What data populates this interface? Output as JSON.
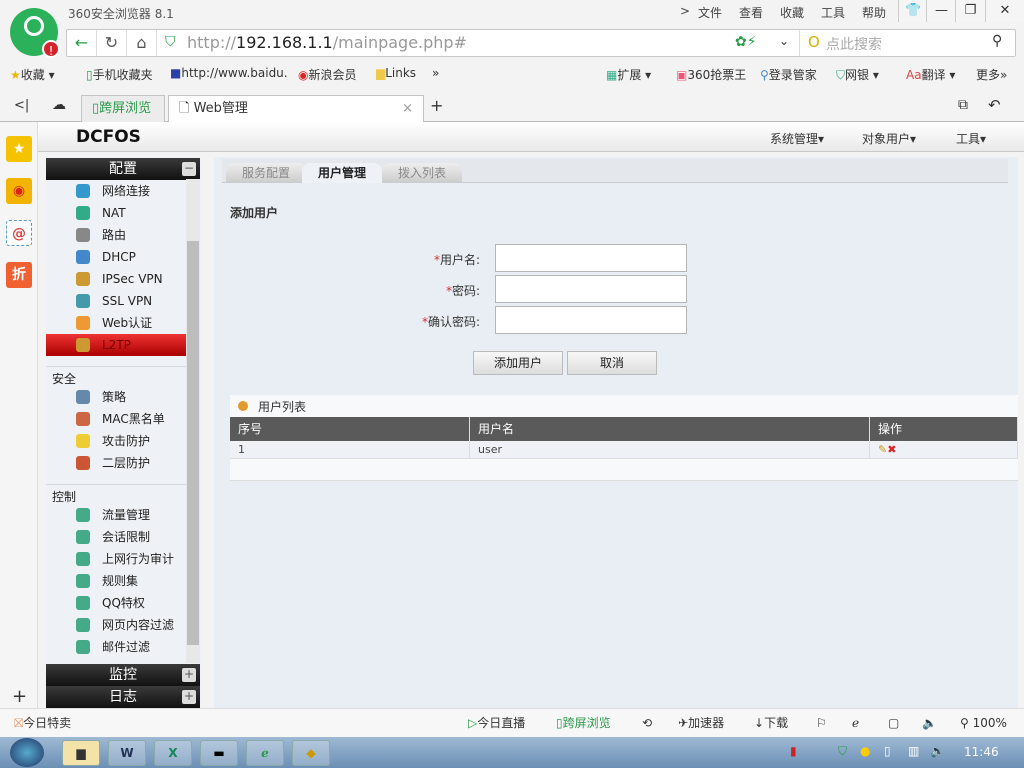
{
  "browser": {
    "title": "360安全浏览器 8.1",
    "menu": [
      ">",
      "文件",
      "查看",
      "收藏",
      "工具",
      "帮助"
    ],
    "url_prefix": "http://",
    "url_host": "192.168.1.1",
    "url_path": "/mainpage.php#",
    "search_placeholder": "点此搜索",
    "bookmarks": [
      "收藏",
      "手机收藏夹",
      "http://www.baidu.",
      "新浪会员",
      "Links",
      "»"
    ],
    "tools": [
      "扩展",
      "360抢票王",
      "登录管家",
      "网银",
      "翻译",
      "更多"
    ],
    "tabs": [
      {
        "label": "跨屏浏览"
      },
      {
        "label": "Web管理"
      }
    ]
  },
  "app": {
    "logo": "DCFOS",
    "menu": [
      "系统管理▾",
      "对象用户▾",
      "工具▾"
    ]
  },
  "nav": {
    "config_header": "配置",
    "config_items": [
      "网络连接",
      "NAT",
      "路由",
      "DHCP",
      "IPSec VPN",
      "SSL VPN",
      "Web认证",
      "L2TP"
    ],
    "security_label": "安全",
    "security_items": [
      "策略",
      "MAC黑名单",
      "攻击防护",
      "二层防护"
    ],
    "control_label": "控制",
    "control_items": [
      "流量管理",
      "会话限制",
      "上网行为审计",
      "规则集",
      "QQ特权",
      "网页内容过滤",
      "邮件过滤"
    ],
    "monitor_header": "监控",
    "log_header": "日志",
    "minus": "−",
    "plus": "+"
  },
  "page": {
    "tabs": [
      "服务配置",
      "用户管理",
      "拨入列表"
    ],
    "section_title": "添加用户",
    "form": {
      "required": "*",
      "username_label": "用户名:",
      "password_label": "密码:",
      "confirm_label": "确认密码:",
      "username": "",
      "password": "",
      "confirm": ""
    },
    "add_button": "添加用户",
    "cancel_button": "取消",
    "list_title": "用户列表",
    "columns": [
      "序号",
      "用户名",
      "操作"
    ],
    "rows": [
      {
        "index": "1",
        "username": "user"
      }
    ]
  },
  "status": {
    "left": "今日特卖",
    "items": [
      "今日直播",
      "跨屏浏览",
      "加速器",
      "下载"
    ],
    "zoom": "100%"
  },
  "taskbar": {
    "clock": "11:46"
  }
}
